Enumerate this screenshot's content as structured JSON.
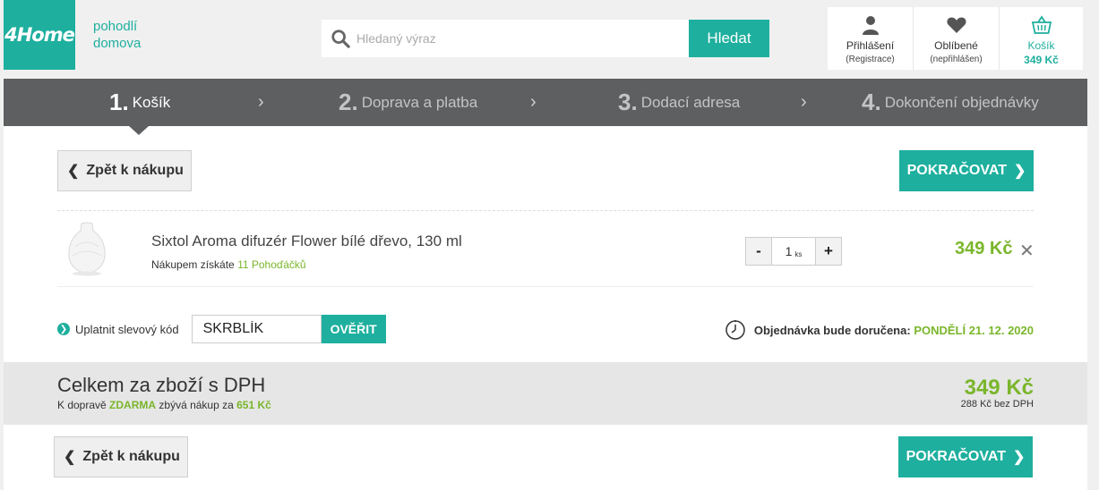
{
  "header": {
    "logo": "4Home",
    "tagline_line1": "pohodlí",
    "tagline_line2": "domova",
    "search_placeholder": "Hledaný výraz",
    "search_button": "Hledat",
    "login_label": "Přihlášení",
    "login_sub": "(Registrace)",
    "favorites_label": "Oblíbené",
    "favorites_sub": "(nepřihlášen)",
    "cart_label": "Košík",
    "cart_total": "349 Kč"
  },
  "steps": [
    {
      "num": "1.",
      "label": "Košík",
      "active": true
    },
    {
      "num": "2.",
      "label": "Doprava a platba"
    },
    {
      "num": "3.",
      "label": "Dodací adresa"
    },
    {
      "num": "4.",
      "label": "Dokončení objednávky"
    }
  ],
  "actions": {
    "back_label": "Zpět k nákupu",
    "continue_label": "POKRAČOVAT"
  },
  "cart_item": {
    "name": "Sixtol Aroma difuzér Flower bílé dřevo, 130 ml",
    "reward_prefix": "Nákupem získáte",
    "reward_value": "11 Pohoďáčků",
    "quantity": "1",
    "unit": "ks",
    "minus": "-",
    "plus": "+",
    "price": "349 Kč",
    "remove": "✕"
  },
  "coupon": {
    "label": "Uplatnit slevový kód",
    "code": "SKRBLÍK",
    "verify_label": "OVĚŘIT"
  },
  "delivery": {
    "prefix": "Objednávka bude doručena:",
    "date": "PONDĚLÍ 21. 12. 2020"
  },
  "totals": {
    "title": "Celkem za zboží s DPH",
    "shipping_prefix": "K dopravě",
    "shipping_free": "ZDARMA",
    "shipping_middle": "zbývá nákup za",
    "shipping_remaining": "651 Kč",
    "price": "349 Kč",
    "price_without_vat": "288 Kč bez DPH"
  },
  "colors": {
    "brand": "#1eaf9e",
    "price_green": "#7ab62b",
    "steps_bg": "#5d5f61"
  }
}
